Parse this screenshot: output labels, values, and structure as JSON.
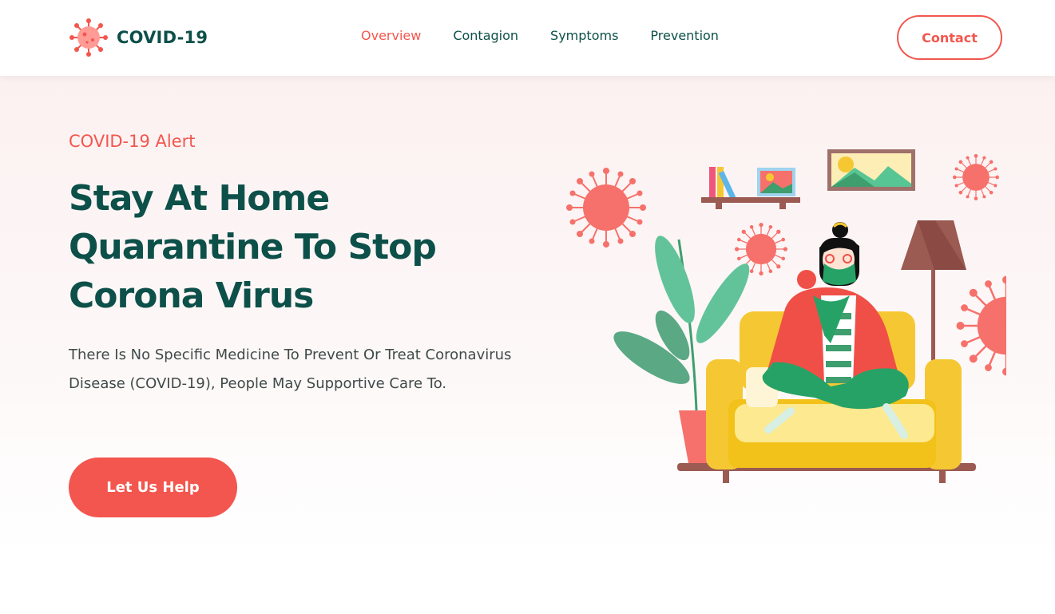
{
  "brand": {
    "name": "COVID-19",
    "icon": "virus-icon"
  },
  "nav": {
    "items": [
      {
        "label": "Overview",
        "active": true
      },
      {
        "label": "Contagion",
        "active": false
      },
      {
        "label": "Symptoms",
        "active": false
      },
      {
        "label": "Prevention",
        "active": false
      }
    ],
    "contact_label": "Contact"
  },
  "hero": {
    "alert": "COVID-19 Alert",
    "title_lines": [
      "Stay At Home",
      "Quarantine To Stop",
      "Corona Virus"
    ],
    "description": "There Is No Specific Medicine To Prevent Or Treat Coronavirus Disease (COVID-19), People May Supportive Care To.",
    "cta_label": "Let Us Help"
  },
  "colors": {
    "accent": "#f3564e",
    "primary": "#0c5049",
    "text": "#3f4a49",
    "hero_bg": "#fcf1f1"
  }
}
